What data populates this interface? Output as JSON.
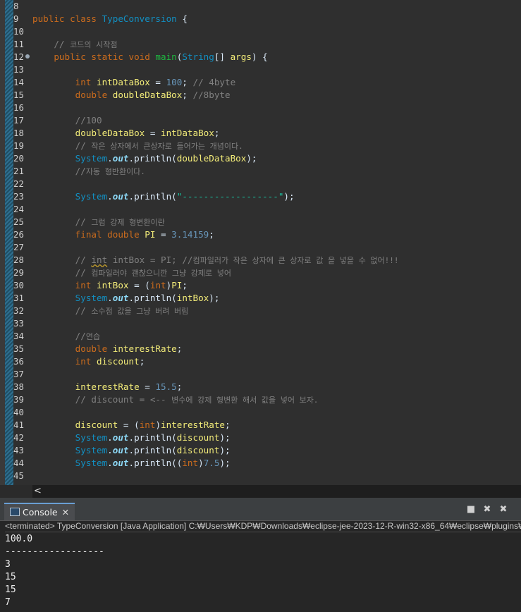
{
  "editor": {
    "lines": [
      {
        "n": "8",
        "segs": []
      },
      {
        "n": "9",
        "segs": [
          [
            "kw",
            "public class "
          ],
          [
            "cls",
            "TypeConversion"
          ],
          [
            "p",
            " {"
          ]
        ]
      },
      {
        "n": "10",
        "segs": []
      },
      {
        "n": "11",
        "segs": [
          [
            "p",
            "    "
          ],
          [
            "cmt",
            "// "
          ],
          [
            "cmtk",
            "코드의 시작점"
          ]
        ]
      },
      {
        "n": "12",
        "marker": true,
        "segs": [
          [
            "p",
            "    "
          ],
          [
            "kw",
            "public static void "
          ],
          [
            "fn",
            "main"
          ],
          [
            "p",
            "("
          ],
          [
            "cls",
            "String"
          ],
          [
            "p",
            "[] "
          ],
          [
            "var",
            "args"
          ],
          [
            "p",
            ") {"
          ]
        ]
      },
      {
        "n": "13",
        "segs": []
      },
      {
        "n": "14",
        "segs": [
          [
            "p",
            "        "
          ],
          [
            "kw",
            "int "
          ],
          [
            "var",
            "intDataBox"
          ],
          [
            "p",
            " = "
          ],
          [
            "num",
            "100"
          ],
          [
            "p",
            "; "
          ],
          [
            "cmt",
            "// 4byte"
          ]
        ]
      },
      {
        "n": "15",
        "segs": [
          [
            "p",
            "        "
          ],
          [
            "kw",
            "double "
          ],
          [
            "var",
            "doubleDataBox"
          ],
          [
            "p",
            "; "
          ],
          [
            "cmt",
            "//8byte"
          ]
        ]
      },
      {
        "n": "16",
        "segs": []
      },
      {
        "n": "17",
        "segs": [
          [
            "p",
            "        "
          ],
          [
            "cmt",
            "//100"
          ]
        ]
      },
      {
        "n": "18",
        "segs": [
          [
            "p",
            "        "
          ],
          [
            "var",
            "doubleDataBox"
          ],
          [
            "p",
            " = "
          ],
          [
            "var",
            "intDataBox"
          ],
          [
            "p",
            ";"
          ]
        ]
      },
      {
        "n": "19",
        "segs": [
          [
            "p",
            "        "
          ],
          [
            "cmt",
            "// "
          ],
          [
            "cmtk",
            "작은 상자에서 큰상자로 들어가는 개념이다."
          ]
        ]
      },
      {
        "n": "20",
        "segs": [
          [
            "p",
            "        "
          ],
          [
            "cls",
            "System"
          ],
          [
            "p",
            "."
          ],
          [
            "out",
            "out"
          ],
          [
            "p",
            ".println("
          ],
          [
            "var",
            "doubleDataBox"
          ],
          [
            "p",
            ");"
          ]
        ]
      },
      {
        "n": "21",
        "segs": [
          [
            "p",
            "        "
          ],
          [
            "cmt",
            "//"
          ],
          [
            "cmtk",
            "자동 형반환이다."
          ]
        ]
      },
      {
        "n": "22",
        "segs": []
      },
      {
        "n": "23",
        "segs": [
          [
            "p",
            "        "
          ],
          [
            "cls",
            "System"
          ],
          [
            "p",
            "."
          ],
          [
            "out",
            "out"
          ],
          [
            "p",
            ".println("
          ],
          [
            "str",
            "\"------------------\""
          ],
          [
            "p",
            ");"
          ]
        ]
      },
      {
        "n": "24",
        "segs": []
      },
      {
        "n": "25",
        "segs": [
          [
            "p",
            "        "
          ],
          [
            "cmt",
            "// "
          ],
          [
            "cmtk",
            "그럼 강제 형변환이란"
          ]
        ]
      },
      {
        "n": "26",
        "segs": [
          [
            "p",
            "        "
          ],
          [
            "kw",
            "final double "
          ],
          [
            "const",
            "PI"
          ],
          [
            "p",
            " = "
          ],
          [
            "num",
            "3.14159"
          ],
          [
            "p",
            ";"
          ]
        ]
      },
      {
        "n": "27",
        "segs": []
      },
      {
        "n": "28",
        "segs": [
          [
            "p",
            "        "
          ],
          [
            "cmt",
            "// "
          ],
          [
            "cmtw",
            "int"
          ],
          [
            "cmt",
            " intBox = PI; //"
          ],
          [
            "cmtk",
            "컴파일러가 작은 상자에 큰 상자로 값 을 넣을 수 없어!!!"
          ]
        ]
      },
      {
        "n": "29",
        "segs": [
          [
            "p",
            "        "
          ],
          [
            "cmt",
            "// "
          ],
          [
            "cmtk",
            "컴파일러야 괜찮으니깐 그냥 강제로 넣어"
          ]
        ]
      },
      {
        "n": "30",
        "segs": [
          [
            "p",
            "        "
          ],
          [
            "kw",
            "int "
          ],
          [
            "var",
            "intBox"
          ],
          [
            "p",
            " = ("
          ],
          [
            "kw",
            "int"
          ],
          [
            "p",
            ")"
          ],
          [
            "const",
            "PI"
          ],
          [
            "p",
            ";"
          ]
        ]
      },
      {
        "n": "31",
        "segs": [
          [
            "p",
            "        "
          ],
          [
            "cls",
            "System"
          ],
          [
            "p",
            "."
          ],
          [
            "out",
            "out"
          ],
          [
            "p",
            ".println("
          ],
          [
            "var",
            "intBox"
          ],
          [
            "p",
            ");"
          ]
        ]
      },
      {
        "n": "32",
        "segs": [
          [
            "p",
            "        "
          ],
          [
            "cmt",
            "// "
          ],
          [
            "cmtk",
            "소수점 값을 그냥 버려 버림"
          ]
        ]
      },
      {
        "n": "33",
        "segs": []
      },
      {
        "n": "34",
        "segs": [
          [
            "p",
            "        "
          ],
          [
            "cmt",
            "//"
          ],
          [
            "cmtk",
            "연습"
          ]
        ]
      },
      {
        "n": "35",
        "segs": [
          [
            "p",
            "        "
          ],
          [
            "kw",
            "double "
          ],
          [
            "var",
            "interestRate"
          ],
          [
            "p",
            ";"
          ]
        ]
      },
      {
        "n": "36",
        "segs": [
          [
            "p",
            "        "
          ],
          [
            "kw",
            "int "
          ],
          [
            "var",
            "discount"
          ],
          [
            "p",
            ";"
          ]
        ]
      },
      {
        "n": "37",
        "segs": []
      },
      {
        "n": "38",
        "segs": [
          [
            "p",
            "        "
          ],
          [
            "var",
            "interestRate"
          ],
          [
            "p",
            " = "
          ],
          [
            "num",
            "15.5"
          ],
          [
            "p",
            ";"
          ]
        ]
      },
      {
        "n": "39",
        "segs": [
          [
            "p",
            "        "
          ],
          [
            "cmt",
            "// discount = <-- "
          ],
          [
            "cmtk",
            "변수에 강제 형변환 해서 값을 넣어 보자."
          ]
        ]
      },
      {
        "n": "40",
        "segs": []
      },
      {
        "n": "41",
        "segs": [
          [
            "p",
            "        "
          ],
          [
            "var",
            "discount"
          ],
          [
            "p",
            " = ("
          ],
          [
            "kw",
            "int"
          ],
          [
            "p",
            ")"
          ],
          [
            "var",
            "interestRate"
          ],
          [
            "p",
            ";"
          ]
        ]
      },
      {
        "n": "42",
        "segs": [
          [
            "p",
            "        "
          ],
          [
            "cls",
            "System"
          ],
          [
            "p",
            "."
          ],
          [
            "out",
            "out"
          ],
          [
            "p",
            ".println("
          ],
          [
            "var",
            "discount"
          ],
          [
            "p",
            ");"
          ]
        ]
      },
      {
        "n": "43",
        "segs": [
          [
            "p",
            "        "
          ],
          [
            "cls",
            "System"
          ],
          [
            "p",
            "."
          ],
          [
            "out",
            "out"
          ],
          [
            "p",
            ".println("
          ],
          [
            "var",
            "discount"
          ],
          [
            "p",
            ");"
          ]
        ]
      },
      {
        "n": "44",
        "segs": [
          [
            "p",
            "        "
          ],
          [
            "cls",
            "System"
          ],
          [
            "p",
            "."
          ],
          [
            "out",
            "out"
          ],
          [
            "p",
            ".println(("
          ],
          [
            "kw",
            "int"
          ],
          [
            "p",
            ")"
          ],
          [
            "num",
            "7.5"
          ],
          [
            "p",
            ");"
          ]
        ]
      },
      {
        "n": "45",
        "segs": []
      }
    ]
  },
  "scrollbar": {
    "left_arrow": "<"
  },
  "console": {
    "tab_label": "Console",
    "tab_close": "✕",
    "tools": {
      "stop": "■",
      "remove": "✖",
      "remove_all": "✖"
    },
    "status": "<terminated> TypeConversion [Java Application] C:₩Users₩KDP₩Downloads₩eclipse-jee-2023-12-R-win32-x86_64₩eclipse₩plugins₩o",
    "output": [
      "100.0",
      "------------------",
      "3",
      "15",
      "15",
      "7"
    ]
  },
  "colors": {
    "editor_bg": "#2f2f2f",
    "keyword": "#cc6c1d",
    "class": "#1290c3",
    "method": "#1eb540",
    "variable": "#f3ec79",
    "number": "#6897bb",
    "string": "#17c6a3",
    "comment": "#808080"
  }
}
